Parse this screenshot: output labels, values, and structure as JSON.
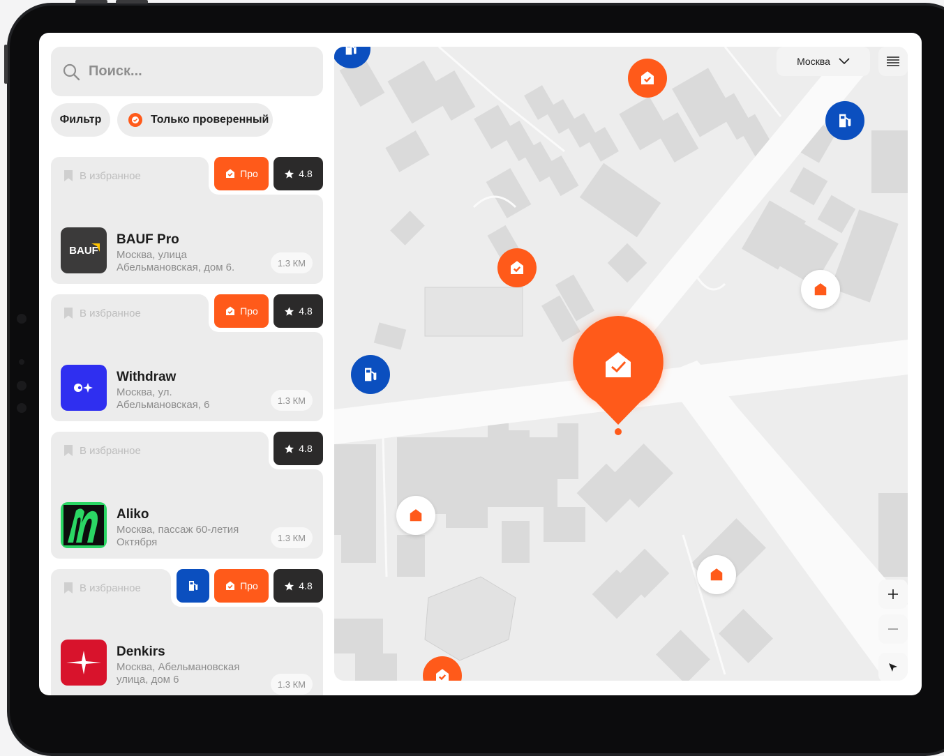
{
  "search": {
    "placeholder": "Поиск..."
  },
  "filters": {
    "filter_label": "Фильтр",
    "verified_label": "Только проверенный"
  },
  "labels": {
    "favorite": "В избранное",
    "pro": "Про"
  },
  "cards": [
    {
      "name": "BAUF Pro",
      "address": "Москва, улица Абельмановская, дом 6.",
      "distance": "1.3 КМ",
      "rating": "4.8",
      "logo_text": "BAUF",
      "pro": true,
      "fuel": false
    },
    {
      "name": "Withdraw",
      "address": "Москва, ул. Абельмановская, 6",
      "distance": "1.3 КМ",
      "rating": "4.8",
      "pro": true,
      "fuel": false
    },
    {
      "name": "Aliko",
      "address": "Москва, пассаж 60-летия Октября",
      "distance": "1.3 КМ",
      "rating": "4.8",
      "pro": false,
      "fuel": false
    },
    {
      "name": "Denkirs",
      "address": "Москва, Абельмановская улица, дом 6",
      "distance": "1.3 КМ",
      "rating": "4.8",
      "pro": true,
      "fuel": true
    }
  ],
  "map": {
    "city": "Москва"
  },
  "colors": {
    "accent": "#ff5a1a",
    "fuel": "#0b4fbf",
    "rating_bg": "#2b2a2a",
    "card_bg": "#ececec"
  },
  "icons": [
    "search-icon",
    "check-badge-icon",
    "bookmark-icon",
    "star-icon",
    "fuel-icon",
    "chevron-down-icon",
    "menu-icon",
    "plus-icon",
    "minus-icon",
    "locate-arrow-icon",
    "house-icon",
    "verified-house-icon"
  ]
}
